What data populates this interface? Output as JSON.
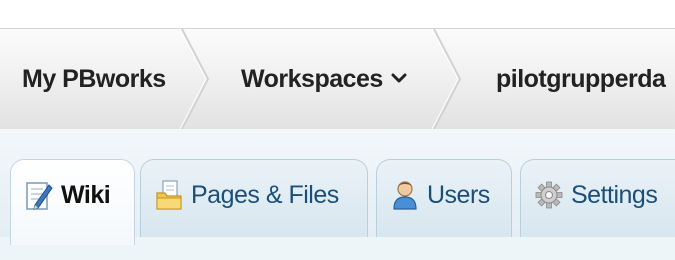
{
  "breadcrumb": {
    "home": "My PBworks",
    "workspaces": "Workspaces",
    "workspace_name": "pilotgrupperda"
  },
  "tabs": [
    {
      "label": "Wiki",
      "icon": "wiki-edit-icon",
      "active": true
    },
    {
      "label": "Pages & Files",
      "icon": "folder-pages-icon",
      "active": false
    },
    {
      "label": "Users",
      "icon": "user-icon",
      "active": false
    },
    {
      "label": "Settings",
      "icon": "gear-icon",
      "active": false
    }
  ],
  "colors": {
    "tab_link": "#1a4f7a",
    "tab_border": "#b9cfdc",
    "crumb_text": "#222222"
  }
}
